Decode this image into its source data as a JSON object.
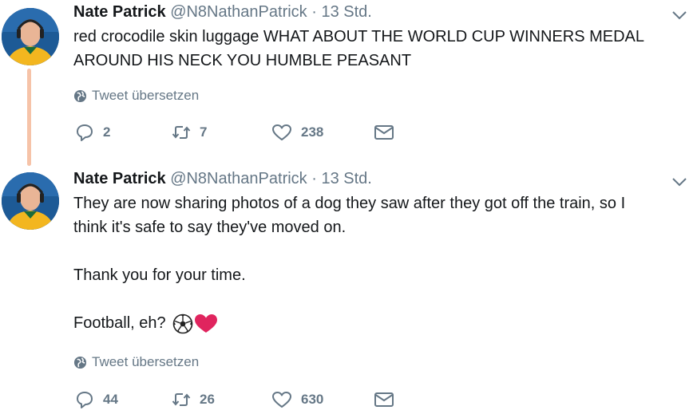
{
  "tweets": [
    {
      "name": "Nate Patrick",
      "handle": "@N8NathanPatrick",
      "separator": "·",
      "time": "13 Std.",
      "lines": [
        "red crocodile skin luggage WHAT ABOUT THE WORLD CUP WINNERS MEDAL",
        "AROUND HIS NECK YOU HUMBLE PEASANT"
      ],
      "translate_label": "Tweet übersetzen",
      "replies": "2",
      "retweets": "7",
      "likes": "238"
    },
    {
      "name": "Nate Patrick",
      "handle": "@N8NathanPatrick",
      "separator": "·",
      "time": "13 Std.",
      "lines": [
        "They are now sharing photos of a dog they saw after they got off the train, so I",
        "think it's safe to say they've moved on.",
        "",
        "Thank you for your time.",
        "",
        "Football, eh?"
      ],
      "translate_label": "Tweet übersetzen",
      "replies": "44",
      "retweets": "26",
      "likes": "630"
    }
  ],
  "icons": {
    "globe": "globe-icon",
    "reply": "reply-icon",
    "retweet": "retweet-icon",
    "like": "heart-icon",
    "dm": "envelope-icon",
    "caret": "chevron-down-icon",
    "emoji": [
      "soccer-ball-emoji",
      "red-heart-emoji"
    ]
  },
  "colors": {
    "text": "#14171a",
    "muted": "#657786",
    "thread_line": "#f6c3a8",
    "heart_red": "#e0245e"
  }
}
